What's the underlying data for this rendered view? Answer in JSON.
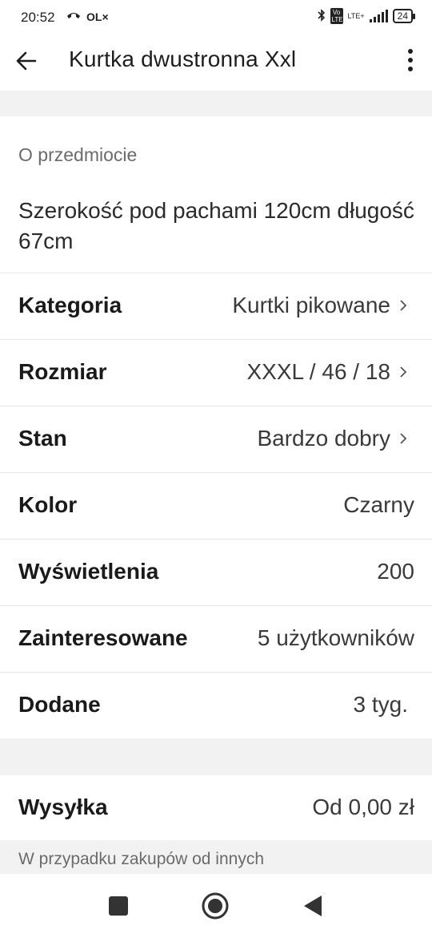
{
  "status_bar": {
    "time": "20:52",
    "notifications": [
      "✈",
      "OLX"
    ],
    "network": "LTE+",
    "battery": "24"
  },
  "app_bar": {
    "back_icon": "arrow-left-icon",
    "title": "Kurtka dwustronna Xxl",
    "menu_icon": "more-vertical-icon"
  },
  "about": {
    "label": "O przedmiocie",
    "description": "Szerokość pod pachami 120cm długość 67cm"
  },
  "details": [
    {
      "label": "Kategoria",
      "value": "Kurtki pikowane",
      "clickable": true
    },
    {
      "label": "Rozmiar",
      "value": "XXXL / 46 / 18",
      "clickable": true
    },
    {
      "label": "Stan",
      "value": "Bardzo dobry",
      "clickable": true
    },
    {
      "label": "Kolor",
      "value": "Czarny",
      "clickable": false
    },
    {
      "label": "Wyświetlenia",
      "value": "200",
      "clickable": false
    },
    {
      "label": "Zainteresowane",
      "value": "5 użytkowników",
      "clickable": false
    },
    {
      "label": "Dodane",
      "value": "3 tyg.",
      "clickable": false
    }
  ],
  "shipping": {
    "label": "Wysyłka",
    "value": "Od 0,00 zł"
  },
  "footer_note": "W przypadku zakupów od innych",
  "colors": {
    "background": "#ffffff",
    "divider_band": "#f2f2f2",
    "text_primary": "#1a1a1a",
    "text_secondary": "#6b6b6b"
  },
  "nav_bar": {
    "recents_icon": "square-icon",
    "home_icon": "circle-icon",
    "back_icon": "triangle-back-icon"
  }
}
